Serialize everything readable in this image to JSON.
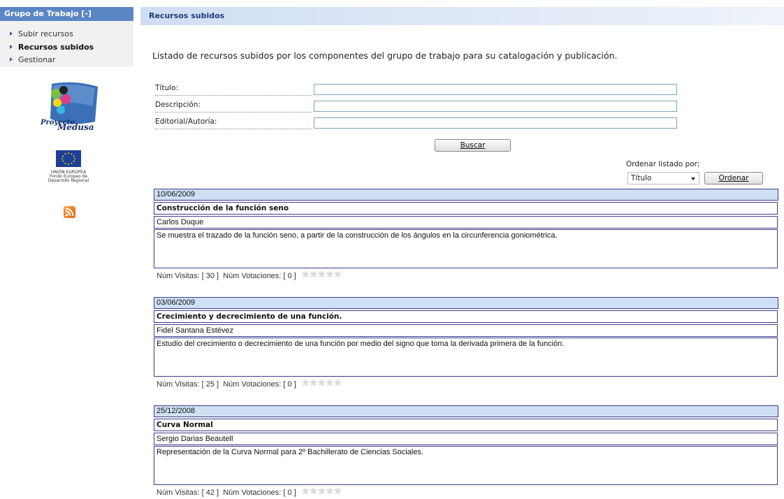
{
  "sidebar": {
    "header": "Grupo de Trabajo  [-]",
    "items": [
      {
        "label": "Subir recursos",
        "active": false
      },
      {
        "label": "Recursos subidos",
        "active": true
      },
      {
        "label": "Gestionar",
        "active": false
      }
    ],
    "logo_text": "Proyecto Medusa",
    "eu_text": [
      "UNIÓN EUROPEA",
      "Fondo Europeo de",
      "Desarrollo Regional"
    ]
  },
  "main": {
    "header": "Recursos subidos",
    "intro": "Listado de recursos subidos por los componentes del grupo de trabajo para su catalogación y publicación.",
    "form": {
      "titulo_label": "Título:",
      "descripcion_label": "Descripción:",
      "editorial_label": "Editorial/Autoría:",
      "titulo_value": "",
      "descripcion_value": "",
      "editorial_value": "",
      "search_button": "Buscar"
    },
    "order": {
      "label": "Ordenar listado por:",
      "selected": "Título",
      "button": "Ordenar"
    },
    "stats_labels": {
      "visits": "Núm Visitas:",
      "votes": "Núm Votaciones:"
    },
    "resources": [
      {
        "date": "10/06/2009",
        "title": "Construcción de la función seno",
        "author": "Carlos Duque",
        "description": "Se muestra el trazado de la función seno, a partir de la construcción de los ángulos en la circunferencia goniométrica.",
        "visits": "[ 30 ]",
        "votes": "[ 0 ]",
        "rating": 0
      },
      {
        "date": "03/06/2009",
        "title": "Crecimiento y decrecimiento de una función.",
        "author": "Fidel Santana Estévez",
        "description": "Estudio del crecimiento o decrecimiento de una función por medio del signo que toma la derivada primera de la función.",
        "visits": "[ 25 ]",
        "votes": "[ 0 ]",
        "rating": 0
      },
      {
        "date": "25/12/2008",
        "title": "Curva Normal",
        "author": "Sergio Darias Beautell",
        "description": "Representación de la Curva Normal para 2º Bachillerato de Ciencias Sociales.",
        "visits": "[ 42 ]",
        "votes": "[ 0 ]",
        "rating": 0
      }
    ]
  },
  "colors": {
    "sidebar_header": "#5b86c5",
    "date_bar": "#cfe0f5",
    "border": "#3d3d8c",
    "star_empty": "#dcdcdc"
  }
}
